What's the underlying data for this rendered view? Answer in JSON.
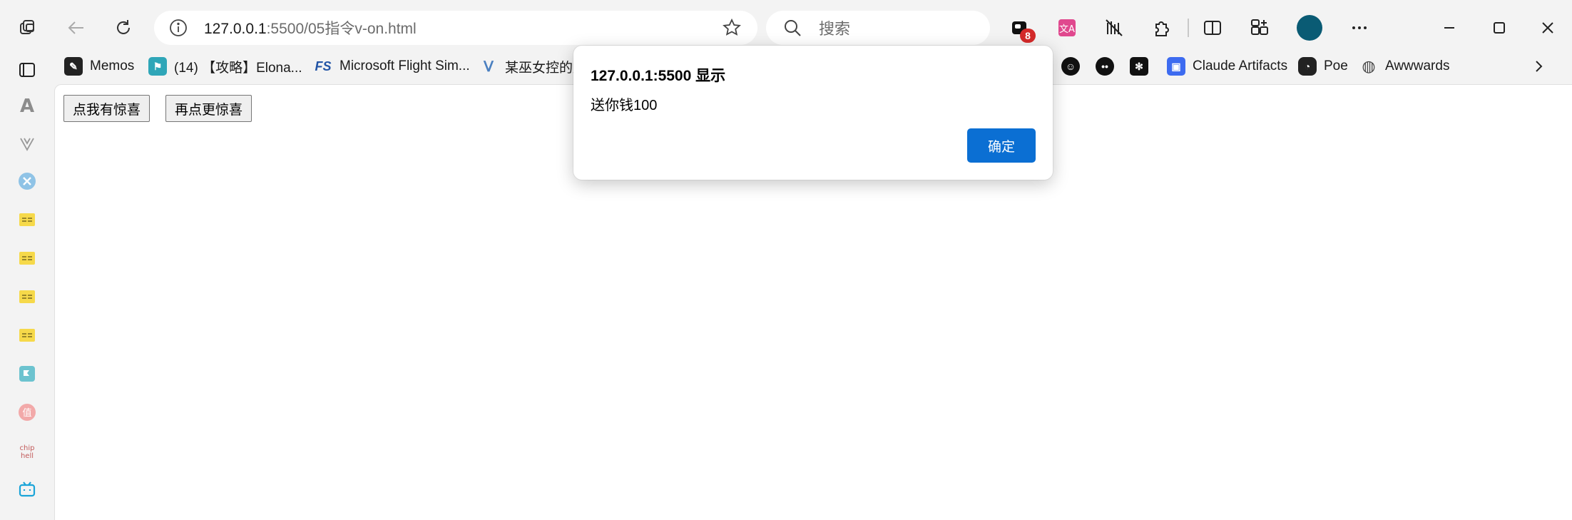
{
  "browser": {
    "address": {
      "host": "127.0.0.1",
      "rest": ":5500/05指令v-on.html"
    },
    "search_placeholder": "搜索",
    "extension_badge": "8"
  },
  "favorites": [
    {
      "label": "Memos",
      "icon": "memos-icon",
      "color": "#222222"
    },
    {
      "label": "(14) 【攻略】Elona...",
      "icon": "elona-icon",
      "color": "#2fa6b8"
    },
    {
      "label": "Microsoft Flight Sim...",
      "icon": "flight-sim-icon",
      "color": "#2355a6"
    },
    {
      "label": "某巫女控的后",
      "icon": "blog-icon",
      "color": "#4a7fc0"
    },
    {
      "label": "Claude Artifacts",
      "icon": "claude-artifacts-icon",
      "color": "#3d6bf0"
    },
    {
      "label": "Poe",
      "icon": "poe-icon",
      "color": "#222222"
    },
    {
      "label": "Awwwards",
      "icon": "globe-icon",
      "color": "#444444"
    }
  ],
  "page": {
    "button1": "点我有惊喜",
    "button2": "再点更惊喜"
  },
  "dialog": {
    "title": "127.0.0.1:5500 显示",
    "message": "送你钱100",
    "ok_label": "确定"
  },
  "colors": {
    "accent": "#0b6fd3",
    "avatar": "#0a5b74",
    "badge": "#d42a2a"
  }
}
